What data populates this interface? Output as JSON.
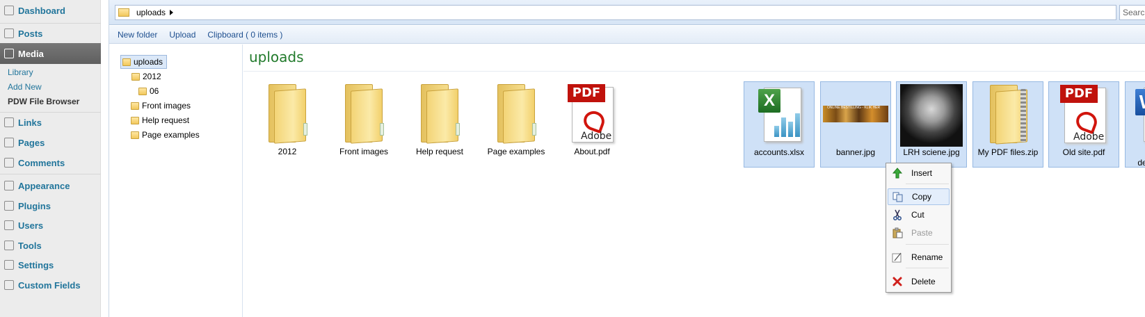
{
  "wp_menu": {
    "items": [
      {
        "label": "Dashboard",
        "icon": "dashboard-icon"
      },
      {
        "label": "Posts",
        "icon": "posts-icon"
      },
      {
        "label": "Media",
        "icon": "media-icon"
      },
      {
        "label": "Links",
        "icon": "links-icon"
      },
      {
        "label": "Pages",
        "icon": "pages-icon"
      },
      {
        "label": "Comments",
        "icon": "comments-icon"
      },
      {
        "label": "Appearance",
        "icon": "appearance-icon"
      },
      {
        "label": "Plugins",
        "icon": "plugins-icon"
      },
      {
        "label": "Users",
        "icon": "users-icon"
      },
      {
        "label": "Tools",
        "icon": "tools-icon"
      },
      {
        "label": "Settings",
        "icon": "settings-icon"
      },
      {
        "label": "Custom Fields",
        "icon": "custom-fields-icon"
      }
    ],
    "active": "Media",
    "media_submenu": [
      "Library",
      "Add New",
      "PDW File Browser"
    ],
    "current_submenu": "PDW File Browser"
  },
  "pathbar": {
    "path": "uploads",
    "search_placeholder": "Search"
  },
  "toolbar": {
    "new_folder": "New folder",
    "upload": "Upload",
    "clipboard": "Clipboard ( 0 items )"
  },
  "tree": {
    "root": "uploads",
    "nodes": [
      "2012",
      "06",
      "Front images",
      "Help request",
      "Page examples"
    ]
  },
  "main": {
    "title": "uploads",
    "items": [
      {
        "label": "2012",
        "type": "folder",
        "selected": false
      },
      {
        "label": "Front images",
        "type": "folder",
        "selected": false
      },
      {
        "label": "Help request",
        "type": "folder",
        "selected": false
      },
      {
        "label": "Page examples",
        "type": "folder",
        "selected": false
      },
      {
        "label": "About.pdf",
        "type": "pdf",
        "selected": false
      },
      {
        "label": "accounts.xlsx",
        "type": "excel",
        "selected": true
      },
      {
        "label": "banner.jpg",
        "type": "image",
        "selected": true
      },
      {
        "label": "LRH sciene.jpg",
        "type": "photo",
        "selected": true
      },
      {
        "label": "My PDF files.zip",
        "type": "zip",
        "selected": true
      },
      {
        "label": "Old site.pdf",
        "type": "pdf",
        "selected": true
      },
      {
        "label": "Project details.docx",
        "type": "word",
        "selected": true
      }
    ],
    "pdf_badge": "PDF",
    "pdf_brand": "Adobe",
    "banner_caption": "ONLINE BESTILLING - KLIK HER"
  },
  "context_menu": {
    "items": [
      {
        "label": "Insert",
        "icon": "insert-arrow-icon",
        "enabled": true
      },
      {
        "label": "Copy",
        "icon": "copy-icon",
        "enabled": true,
        "highlighted": true
      },
      {
        "label": "Cut",
        "icon": "scissors-icon",
        "enabled": true
      },
      {
        "label": "Paste",
        "icon": "paste-icon",
        "enabled": false
      },
      {
        "label": "Rename",
        "icon": "rename-icon",
        "enabled": true
      },
      {
        "label": "Delete",
        "icon": "delete-icon",
        "enabled": true
      }
    ]
  },
  "colors": {
    "wp_link": "#21759b",
    "wp_active_bg": "#6d6d6d",
    "fb_title": "#217a2b",
    "selection_bg": "#cfe1f7",
    "pdf_red": "#c0120c"
  }
}
